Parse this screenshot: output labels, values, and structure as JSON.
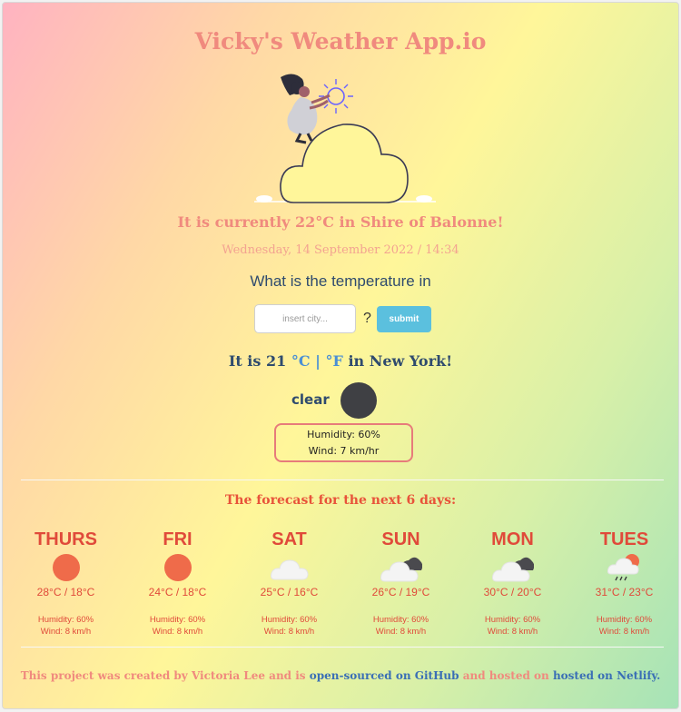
{
  "app": {
    "title": "Vicky's Weather App.io"
  },
  "current": {
    "sentence": "It is currently 22°C in Shire of Balonne!",
    "datetime": "Wednesday, 14 September 2022 / 14:34"
  },
  "search": {
    "question": "What is the temperature in",
    "placeholder": "insert city...",
    "question_mark": "?",
    "submit_label": "submit"
  },
  "result": {
    "prefix": "It is",
    "temperature": "21",
    "unit_c": "°C",
    "separator": "|",
    "unit_f": "°F",
    "suffix": "in New York!",
    "condition": "clear",
    "humidity": "Humidity: 60%",
    "wind": "Wind: 7 km/hr"
  },
  "forecast": {
    "title": "The forecast for the next 6 days:",
    "days": [
      {
        "name": "THURS",
        "icon": "sun-icon",
        "temp": "28°C / 18°C",
        "humidity": "Humidity: 60%",
        "wind": "Wind: 8 km/h"
      },
      {
        "name": "FRI",
        "icon": "sun-icon",
        "temp": "24°C / 18°C",
        "humidity": "Humidity: 60%",
        "wind": "Wind: 8 km/h"
      },
      {
        "name": "SAT",
        "icon": "cloud-icon",
        "temp": "25°C / 16°C",
        "humidity": "Humidity: 60%",
        "wind": "Wind: 8 km/h"
      },
      {
        "name": "SUN",
        "icon": "dark-cloud-icon",
        "temp": "26°C / 19°C",
        "humidity": "Humidity: 60%",
        "wind": "Wind: 8 km/h"
      },
      {
        "name": "MON",
        "icon": "dark-cloud-icon",
        "temp": "30°C / 20°C",
        "humidity": "Humidity: 60%",
        "wind": "Wind: 8 km/h"
      },
      {
        "name": "TUES",
        "icon": "rain-cloud-icon",
        "temp": "31°C / 23°C",
        "humidity": "Humidity: 60%",
        "wind": "Wind: 8 km/h"
      }
    ]
  },
  "footer": {
    "text1": "This project was created by Victoria Lee and is",
    "link1": "open-sourced on GitHub",
    "text2": "and hosted on",
    "link2": "hosted on Netlify."
  },
  "colors": {
    "accent": "#f08a7e",
    "navy": "#2f4b6e",
    "forecast_red": "#e04a3a",
    "sun": "#ef6b4a",
    "submit": "#5bc0de"
  }
}
